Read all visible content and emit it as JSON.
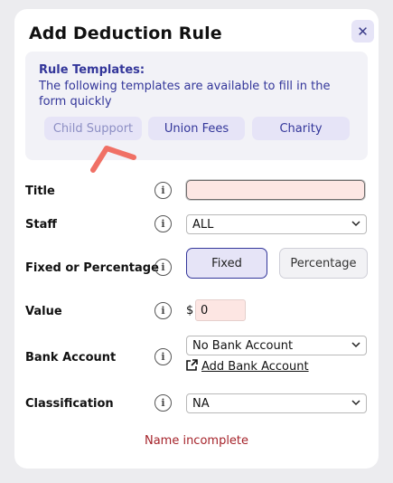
{
  "dialog": {
    "title": "Add Deduction Rule",
    "close_glyph": "✕"
  },
  "templates": {
    "heading": "Rule Templates:",
    "description": "The following templates are available to fill in the form quickly",
    "buttons": [
      "Child Support",
      "Union Fees",
      "Charity"
    ]
  },
  "form": {
    "title_label": "Title",
    "title_value": "",
    "staff_label": "Staff",
    "staff_value": "ALL",
    "fixed_label": "Fixed or Percentage",
    "fixed_options": [
      "Fixed",
      "Percentage"
    ],
    "fixed_selected": "Fixed",
    "value_label": "Value",
    "currency_symbol": "$",
    "value": "0",
    "bank_label": "Bank Account",
    "bank_value": "No Bank Account",
    "add_bank_label": "Add Bank Account",
    "classification_label": "Classification",
    "classification_value": "NA",
    "info_glyph": "i"
  },
  "error": "Name incomplete",
  "icons": {
    "close": "close-icon",
    "info": "info-icon",
    "chevron": "chevron-down-icon",
    "external": "external-link-icon"
  },
  "colors": {
    "accent": "#33369a",
    "accent_bg": "#e6e4f7",
    "invalid_bg": "#fde6e3",
    "error": "#a5232a",
    "annotation": "#f07065"
  }
}
